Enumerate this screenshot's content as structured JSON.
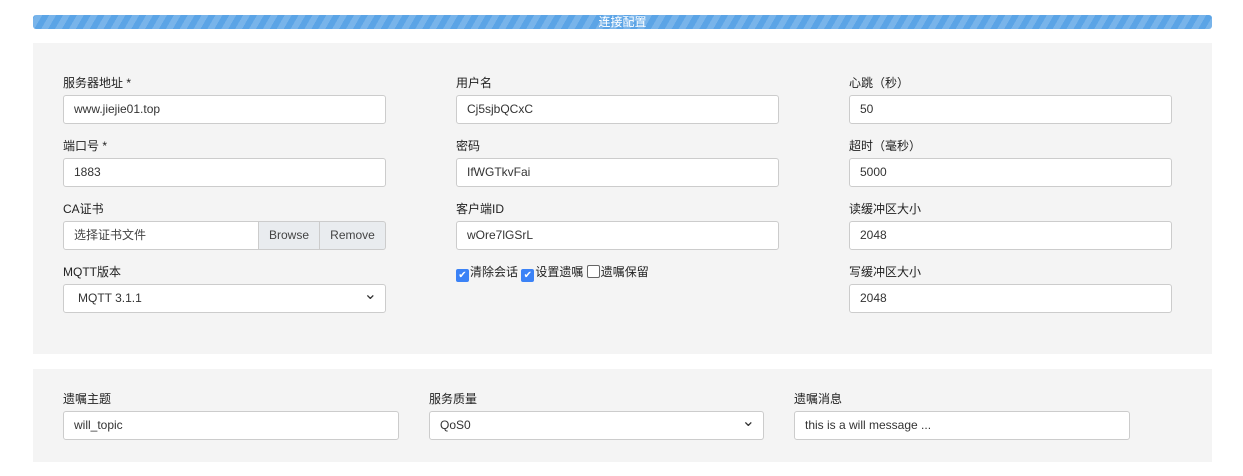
{
  "header": {
    "section_title": "连接配置"
  },
  "connection": {
    "host": {
      "label": "服务器地址 *",
      "value": "www.jiejie01.top"
    },
    "port": {
      "label": "端口号 *",
      "value": "1883"
    },
    "ca": {
      "label": "CA证书",
      "placeholder": "选择证书文件",
      "browse": "Browse",
      "remove": "Remove"
    },
    "mqtt_version": {
      "label": "MQTT版本",
      "value": "MQTT 3.1.1"
    },
    "username": {
      "label": "用户名",
      "value": "Cj5sjbQCxC"
    },
    "password": {
      "label": "密码",
      "value": "IfWGTkvFai"
    },
    "client_id": {
      "label": "客户端ID",
      "value": "wOre7lGSrL"
    },
    "checkboxes": [
      {
        "label": "清除会话",
        "checked": true
      },
      {
        "label": "设置遗嘱",
        "checked": true
      },
      {
        "label": "遗嘱保留",
        "checked": false
      }
    ],
    "keepalive": {
      "label": "心跳（秒）",
      "value": "50"
    },
    "timeout": {
      "label": "超时（毫秒）",
      "value": "5000"
    },
    "read_buffer": {
      "label": "读缓冲区大小",
      "value": "2048"
    },
    "write_buffer": {
      "label": "写缓冲区大小",
      "value": "2048"
    }
  },
  "will": {
    "topic": {
      "label": "遗嘱主题",
      "value": "will_topic"
    },
    "qos": {
      "label": "服务质量",
      "value": "QoS0"
    },
    "message": {
      "label": "遗嘱消息",
      "value": "this is a will message ..."
    }
  }
}
